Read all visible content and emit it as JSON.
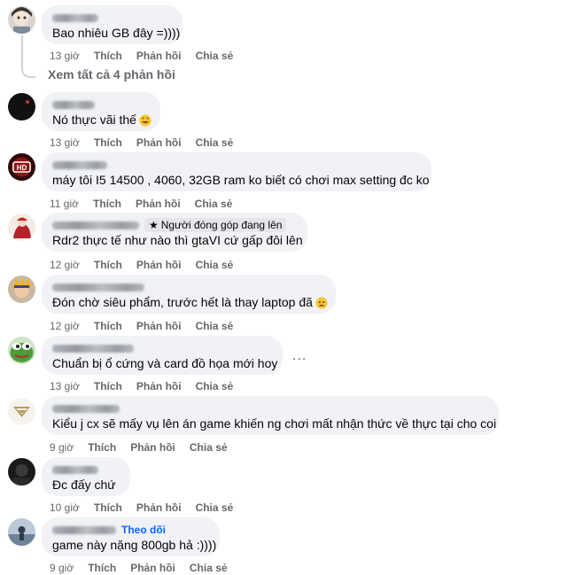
{
  "comments": [
    {
      "text": "Bao nhiêu GB đây =))))",
      "time": "13 giờ"
    },
    {
      "text": "Nó thực vãi thế",
      "time": "13 giờ"
    },
    {
      "text": "máy tôi I5 14500 , 4060, 32GB ram ko biết có chơi max setting đc ko",
      "time": "11 giờ"
    },
    {
      "text": "Rdr2 thực tế như nào thì gtaVI cứ gấp đôi lên",
      "time": "12 giờ",
      "badge": "Người đóng góp đang lên"
    },
    {
      "text": "Đón chờ siêu phẩm, trước hết là thay laptop đã",
      "time": "12 giờ"
    },
    {
      "text": "Chuẩn bị ổ cứng và card đồ họa mới hoy",
      "time": "13 giờ"
    },
    {
      "text": "Kiểu j cx sẽ mấy vụ lên án game khiến ng chơi mất nhận thức về thực tại cho coi",
      "time": "9 giờ"
    },
    {
      "text": "Đc đấy chứ",
      "time": "10 giờ"
    },
    {
      "text": "game này nặng 800gb hả :))))",
      "time": "9 giờ",
      "follow": "Theo dõi"
    }
  ],
  "actions": {
    "like": "Thích",
    "reply": "Phản hồi",
    "share": "Chia sẻ"
  },
  "view_replies": "Xem tất cả 4 phản hồi",
  "more_icon": "..."
}
